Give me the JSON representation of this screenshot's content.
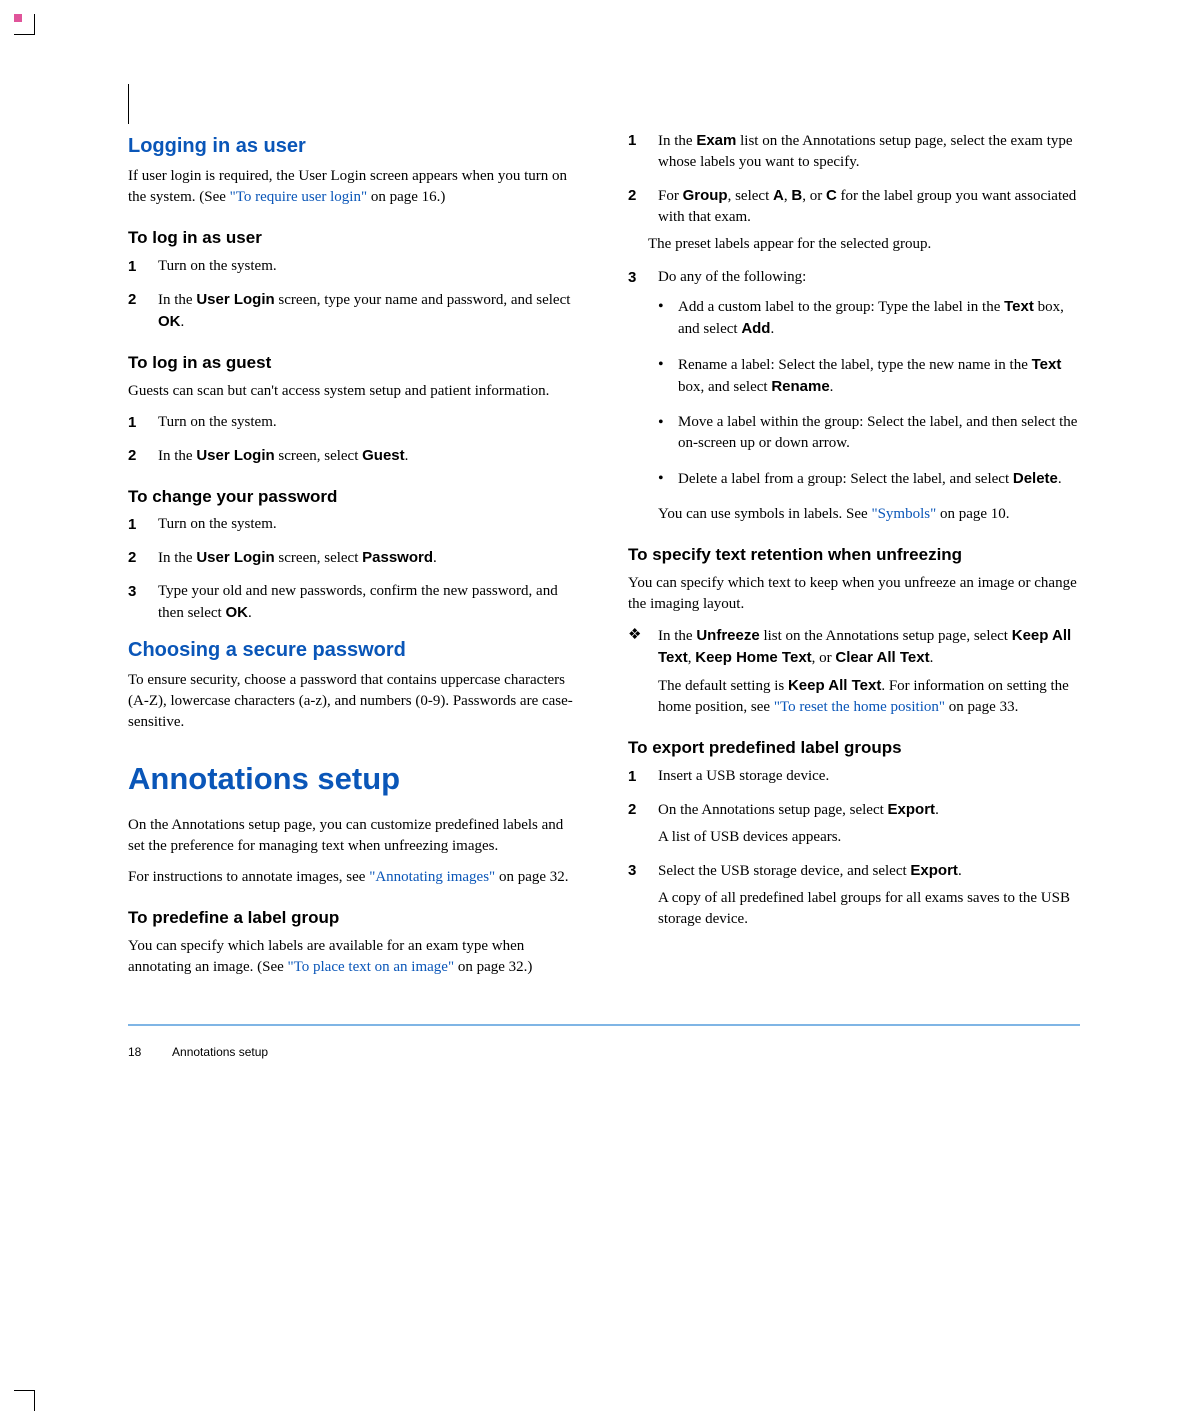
{
  "left": {
    "h_login": "Logging in as user",
    "login_intro_a": "If user login is required, the User Login screen appears when you turn on the system. (See ",
    "login_intro_link": "\"To require user login\"",
    "login_intro_b": " on page 16.)",
    "h_login_user": "To log in as user",
    "login_user_1": "Turn on the system.",
    "login_user_2_a": "In the ",
    "login_user_2_b": "User Login",
    "login_user_2_c": " screen, type your name and password, and select ",
    "login_user_2_d": "OK",
    "login_user_2_e": ".",
    "h_login_guest": "To log in as guest",
    "guest_intro": "Guests can scan but can't access system setup and patient information.",
    "guest_1": "Turn on the system.",
    "guest_2_a": "In the ",
    "guest_2_b": "User Login",
    "guest_2_c": " screen, select ",
    "guest_2_d": "Guest",
    "guest_2_e": ".",
    "h_change_pw": "To change your password",
    "pw_1": "Turn on the system.",
    "pw_2_a": "In the ",
    "pw_2_b": "User Login",
    "pw_2_c": " screen, select ",
    "pw_2_d": "Password",
    "pw_2_e": ".",
    "pw_3_a": "Type your old and new passwords, confirm the new password, and then select ",
    "pw_3_b": "OK",
    "pw_3_c": ".",
    "h_secure": "Choosing a secure password",
    "secure_p": "To ensure security, choose a password that contains uppercase characters (A-Z), lowercase characters (a-z), and numbers (0-9). Passwords are case-sensitive.",
    "h_annot": "Annotations setup",
    "annot_p1": "On the Annotations setup page, you can customize predefined labels and set the preference for managing text when unfreezing images.",
    "annot_p2_a": "For instructions to annotate images, see ",
    "annot_p2_link": "\"Annotating images\"",
    "annot_p2_b": " on page 32.",
    "h_predefine": "To predefine a label group",
    "predefine_p_a": "You can specify which labels are available for an exam type when annotating an image. (See ",
    "predefine_p_link": "\"To place text on an image\"",
    "predefine_p_b": " on page 32.)"
  },
  "right": {
    "r_1_a": "In the ",
    "r_1_b": "Exam",
    "r_1_c": " list on the Annotations setup page, select the exam type whose labels you want to specify.",
    "r_2_a": "For ",
    "r_2_b": "Group",
    "r_2_c": ", select ",
    "r_2_d": "A",
    "r_2_e": ", ",
    "r_2_f": "B",
    "r_2_g": ", or ",
    "r_2_h": "C",
    "r_2_i": " for the label group you want associated with that exam.",
    "r_2_sub": "The preset labels appear for the selected group.",
    "r_3": "Do any of the following:",
    "b1_a": "Add a custom label to the group: Type the label in the ",
    "b1_b": "Text",
    "b1_c": " box, and select ",
    "b1_d": "Add",
    "b1_e": ".",
    "b2_a": "Rename a label: Select the label, type the new name in the ",
    "b2_b": "Text",
    "b2_c": " box, and select ",
    "b2_d": "Rename",
    "b2_e": ".",
    "b3": "Move a label within the group: Select the label, and then select the on-screen up or down arrow.",
    "b4_a": "Delete a label from a group: Select the label, and select ",
    "b4_b": "Delete",
    "b4_c": ".",
    "r_3_after_a": "You can use symbols in labels. See ",
    "r_3_after_link": "\"Symbols\"",
    "r_3_after_b": " on page 10.",
    "h_retention": "To specify text retention when unfreezing",
    "ret_p": "You can specify which text to keep when you unfreeze an image or change the imaging layout.",
    "ret_d_a": "In the ",
    "ret_d_b": "Unfreeze",
    "ret_d_c": " list on the Annotations setup page, select ",
    "ret_d_d": "Keep All Text",
    "ret_d_e": ", ",
    "ret_d_f": "Keep Home Text",
    "ret_d_g": ", or ",
    "ret_d_h": "Clear All Text",
    "ret_d_i": ".",
    "ret_sub_a": "The default setting is ",
    "ret_sub_b": "Keep All Text",
    "ret_sub_c": ". For information on setting the home position, see ",
    "ret_sub_link": "\"To reset the home position\"",
    "ret_sub_d": " on page 33.",
    "h_export": "To export predefined label groups",
    "exp_1": "Insert a USB storage device.",
    "exp_2_a": "On the Annotations setup page, select ",
    "exp_2_b": "Export",
    "exp_2_c": ".",
    "exp_2_sub": "A list of USB devices appears.",
    "exp_3_a": "Select the USB storage device, and select ",
    "exp_3_b": "Export",
    "exp_3_c": ".",
    "exp_3_sub": "A copy of all predefined label groups for all exams saves to the USB storage device."
  },
  "footer": {
    "page": "18",
    "section": "Annotations setup"
  }
}
